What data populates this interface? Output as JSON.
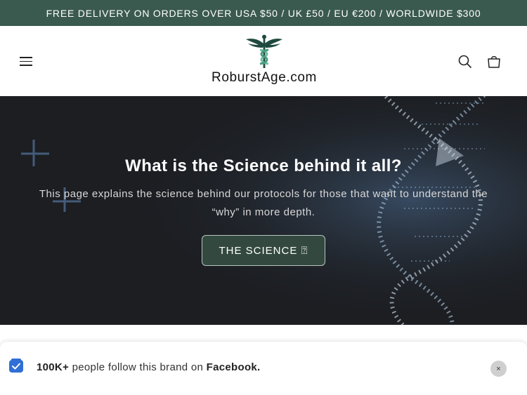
{
  "announcement": {
    "text": "FREE DELIVERY ON ORDERS OVER USA $50 / UK £50 / EU €200 / WORLDWIDE $300"
  },
  "header": {
    "logo_text": "RoburstAge.com",
    "menu_icon": "hamburger-icon",
    "search_icon": "search-icon",
    "cart_icon": "cart-icon"
  },
  "hero": {
    "title": "What is the Science behind it all?",
    "description": "This page explains the science behind our protocols for those that want to understand the “why” in more depth.",
    "button_label": "THE SCIENCE ⍰"
  },
  "notification": {
    "count": "100K+",
    "middle": " people follow this brand on ",
    "platform": "Facebook.",
    "close_label": "×",
    "icon": "checkbox-icon"
  },
  "colors": {
    "brand_green": "#3b5a4f",
    "button_green": "#33493f",
    "hero_bg": "#1c1d20",
    "checkbox_blue": "#2f6fd6"
  }
}
